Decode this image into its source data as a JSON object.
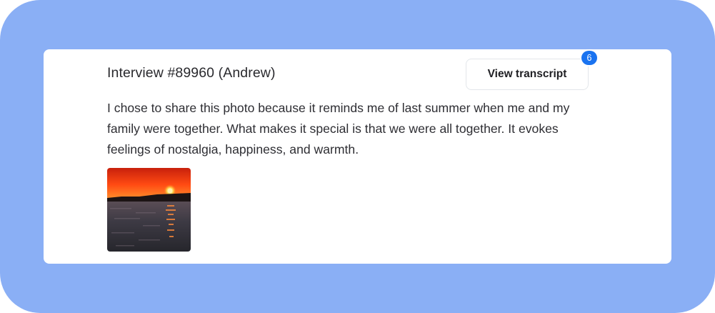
{
  "interview": {
    "title": "Interview #89960 (Andrew)",
    "response": "I chose to share this photo because it reminds me of last summer when me and my family were together. What makes it special is that we were all together. It evokes feelings of nostalgia, happiness, and warmth."
  },
  "transcript_button": {
    "label": "View transcript",
    "badge_count": "6"
  },
  "photo": {
    "icon": "sunset-over-water-photo"
  },
  "colors": {
    "background": "#8aaff5",
    "card": "#ffffff",
    "badge": "#1a73f0",
    "text": "#2e2e33"
  }
}
